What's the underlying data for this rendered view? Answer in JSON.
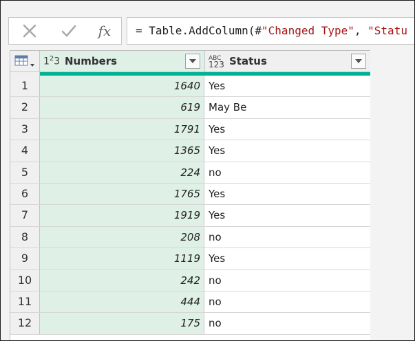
{
  "formula_bar": {
    "cancel_icon": "close-icon",
    "confirm_icon": "check-icon",
    "fx_label": "fx",
    "formula_prefix": "= Table.AddColumn(#",
    "formula_str1": "\"Changed Type\"",
    "formula_mid": ", ",
    "formula_str2": "\"Statu"
  },
  "table": {
    "columns": [
      {
        "type_label": "1²3",
        "name": "Numbers"
      },
      {
        "type_label": "ABC 123",
        "name": "Status"
      }
    ],
    "rows": [
      {
        "index": "1",
        "number": "1640",
        "status": "Yes"
      },
      {
        "index": "2",
        "number": "619",
        "status": "May Be"
      },
      {
        "index": "3",
        "number": "1791",
        "status": "Yes"
      },
      {
        "index": "4",
        "number": "1365",
        "status": "Yes"
      },
      {
        "index": "5",
        "number": "224",
        "status": "no"
      },
      {
        "index": "6",
        "number": "1765",
        "status": "Yes"
      },
      {
        "index": "7",
        "number": "1919",
        "status": "Yes"
      },
      {
        "index": "8",
        "number": "208",
        "status": "no"
      },
      {
        "index": "9",
        "number": "1119",
        "status": "Yes"
      },
      {
        "index": "10",
        "number": "242",
        "status": "no"
      },
      {
        "index": "11",
        "number": "444",
        "status": "no"
      },
      {
        "index": "12",
        "number": "175",
        "status": "no"
      }
    ]
  },
  "colors": {
    "quality_bar": "#00b294",
    "numbers_column_bg": "#dff1e7"
  }
}
